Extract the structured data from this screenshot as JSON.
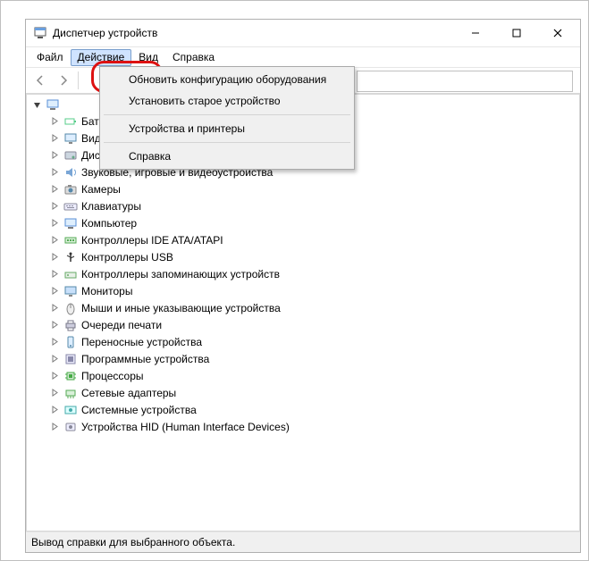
{
  "window": {
    "title": "Диспетчер устройств"
  },
  "menu": {
    "file": "Файл",
    "action": "Действие",
    "view": "Вид",
    "help": "Справка"
  },
  "action_menu": {
    "scan": "Обновить конфигурацию оборудования",
    "legacy": "Установить старое устройство",
    "printers": "Устройства и принтеры",
    "help": "Справка"
  },
  "tree": {
    "root": "",
    "items": [
      "Батареи",
      "Видеоадаптеры",
      "Дисковые устройства",
      "Звуковые, игровые и видеоустройства",
      "Камеры",
      "Клавиатуры",
      "Компьютер",
      "Контроллеры IDE ATA/ATAPI",
      "Контроллеры USB",
      "Контроллеры запоминающих устройств",
      "Мониторы",
      "Мыши и иные указывающие устройства",
      "Очереди печати",
      "Переносные устройства",
      "Программные устройства",
      "Процессоры",
      "Сетевые адаптеры",
      "Системные устройства",
      "Устройства HID (Human Interface Devices)"
    ],
    "icons": [
      "battery",
      "display",
      "disk",
      "sound",
      "camera",
      "keyboard",
      "computer",
      "ide",
      "usb",
      "storage",
      "monitor",
      "mouse",
      "printer",
      "portable",
      "software",
      "cpu",
      "network",
      "system",
      "hid"
    ]
  },
  "status": "Вывод справки для выбранного объекта."
}
